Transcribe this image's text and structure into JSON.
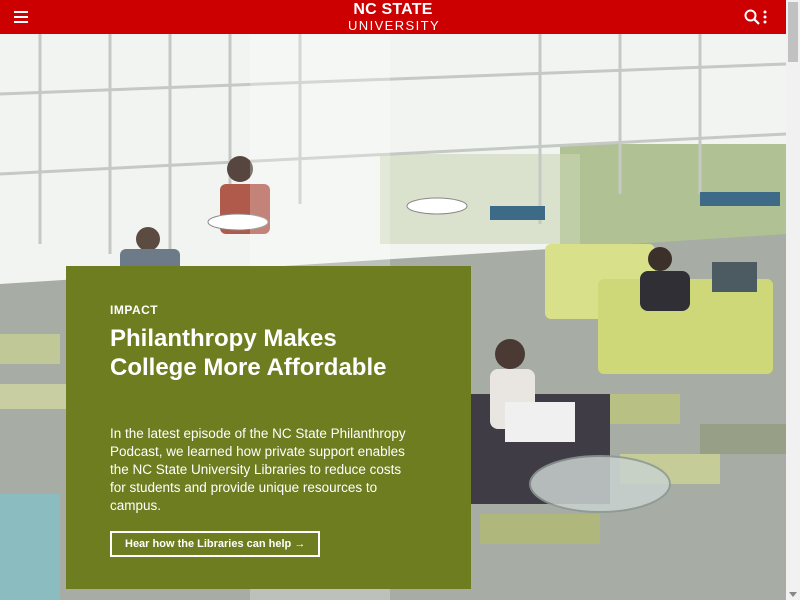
{
  "header": {
    "brand_line1": "NC STATE",
    "brand_line2": "UNIVERSITY",
    "menu_icon": "hamburger-icon",
    "search_icon": "search-icon",
    "more_icon": "vertical-dots-icon",
    "bar_color": "#cc0000"
  },
  "feature": {
    "eyebrow": "IMPACT",
    "headline": "Philanthropy Makes College More Affordable",
    "summary": "In the latest episode of the NC State Philanthropy Podcast, we learned how private support enables the NC State University Libraries to reduce costs for students and provide unique resources to campus.",
    "cta_label": "Hear how the Libraries can help →",
    "card_color": "#6e7d1f"
  },
  "background_photo": "library-lounge-students-photo"
}
